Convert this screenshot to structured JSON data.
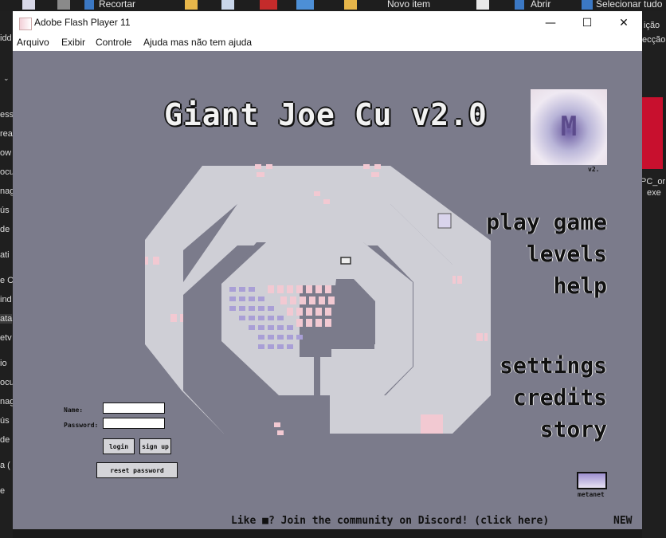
{
  "background": {
    "toolbar_items": [
      "Recortar",
      "Novo item",
      "Abrir",
      "Selecionar tudo"
    ],
    "left_fragments": [
      "idd",
      "esso",
      "rea",
      "ow",
      "ocu",
      "nag",
      "ús",
      "de",
      "ati",
      "e C",
      "ind",
      "ata",
      "etv",
      "io",
      "ocu",
      "nag",
      "ús",
      "de",
      "a (",
      "e"
    ],
    "right_fragments": [
      "ição",
      "ecção",
      "PC_or",
      "exe"
    ]
  },
  "window": {
    "title": "Adobe Flash Player 11",
    "controls": {
      "minimize": "—",
      "maximize": "☐",
      "close": "✕"
    },
    "menu": [
      "Arquivo",
      "Exibir",
      "Controle",
      "Ajuda mas não tem ajuda"
    ]
  },
  "game": {
    "title": "Giant Joe Cu v2.0",
    "logo_version": "v2.",
    "menu": {
      "play": "play game",
      "levels": "levels",
      "help": "help",
      "settings": "settings",
      "credits": "credits",
      "story": "story"
    },
    "login": {
      "name_label": "Name:",
      "password_label": "Password:",
      "login_button": "login",
      "signup_button": "sign up",
      "reset_button": "reset password"
    },
    "metanet_label": "metanet",
    "discord_text": "Like ■? Join the community on Discord! (click here)",
    "news_text": "NEW"
  },
  "colors": {
    "stage": "#7b7b8b",
    "track": "#cfcfd6",
    "accent_pink": "#f2c9d2",
    "accent_purple": "#8f84c4"
  }
}
